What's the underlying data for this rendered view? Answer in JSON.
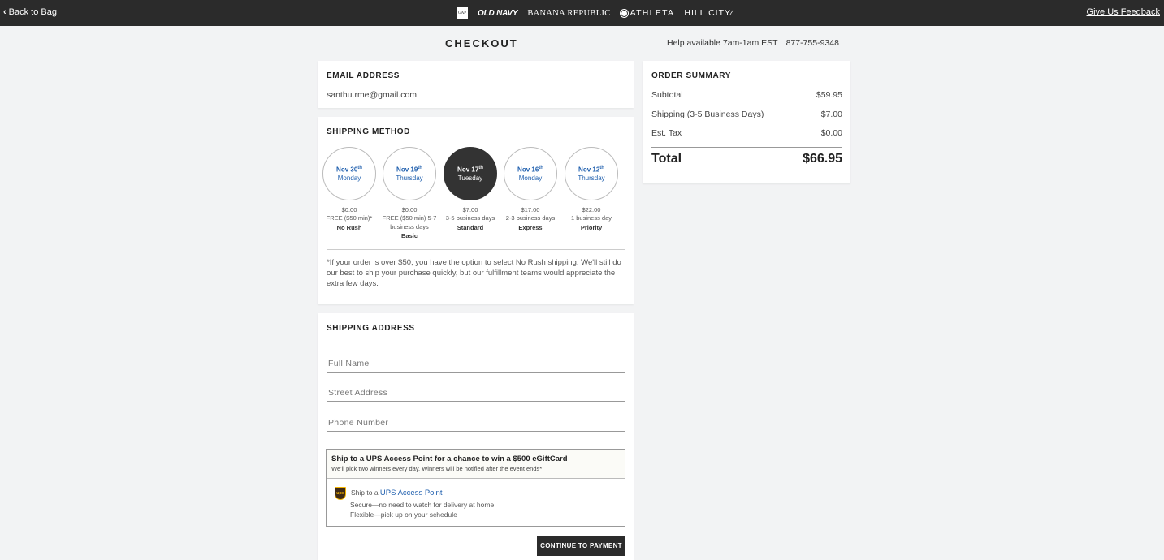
{
  "topbar": {
    "back_label": "Back to Bag",
    "brands": {
      "gap": "GAP",
      "oldnavy": "OLD NAVY",
      "br": "BANANA REPUBLIC",
      "athleta": "ATHLETA",
      "hillcity": "HILL CITY⁄"
    },
    "feedback_label": "Give Us Feedback"
  },
  "header": {
    "title": "CHECKOUT",
    "help_hours": "Help available 7am-1am EST",
    "help_phone": "877-755-9348"
  },
  "email": {
    "title": "EMAIL ADDRESS",
    "value": "santhu.rme@gmail.com"
  },
  "shipping_method": {
    "title": "SHIPPING METHOD",
    "options": [
      {
        "date": "Nov 30",
        "suffix": "th",
        "day": "Monday",
        "price": "$0.00",
        "desc": "FREE ($50 min)*",
        "name": "No Rush",
        "selected": false
      },
      {
        "date": "Nov 19",
        "suffix": "th",
        "day": "Thursday",
        "price": "$0.00",
        "desc": "FREE ($50 min) 5-7 business days",
        "name": "Basic",
        "selected": false
      },
      {
        "date": "Nov 17",
        "suffix": "th",
        "day": "Tuesday",
        "price": "$7.00",
        "desc": "3-5 business days",
        "name": "Standard",
        "selected": true
      },
      {
        "date": "Nov 16",
        "suffix": "th",
        "day": "Monday",
        "price": "$17.00",
        "desc": "2-3 business days",
        "name": "Express",
        "selected": false
      },
      {
        "date": "Nov 12",
        "suffix": "th",
        "day": "Thursday",
        "price": "$22.00",
        "desc": "1 business day",
        "name": "Priority",
        "selected": false
      }
    ],
    "note": "*If your order is over $50, you have the option to select No Rush shipping. We'll still do our best to ship your purchase quickly, but our fulfillment teams would appreciate the extra few days."
  },
  "shipping_address": {
    "title": "SHIPPING ADDRESS",
    "full_name_placeholder": "Full Name",
    "street_placeholder": "Street Address",
    "phone_placeholder": "Phone Number",
    "ups": {
      "heading": "Ship to a UPS Access Point for a chance to win a $500 eGiftCard",
      "subheading": "We'll pick two winners every day. Winners will be notified after the event ends*",
      "logo_text": "ups",
      "ship_prefix": "Ship to a ",
      "link_text": "UPS Access Point",
      "benefit_1": "Secure—no need to watch for delivery at home",
      "benefit_2": "Flexible—pick up on your schedule"
    },
    "continue_label": "CONTINUE TO PAYMENT"
  },
  "order_summary": {
    "title": "ORDER SUMMARY",
    "subtotal_label": "Subtotal",
    "subtotal_value": "$59.95",
    "shipping_label": "Shipping (3-5 Business Days)",
    "shipping_value": "$7.00",
    "tax_label": "Est. Tax",
    "tax_value": "$0.00",
    "total_label": "Total",
    "total_value": "$66.95"
  }
}
